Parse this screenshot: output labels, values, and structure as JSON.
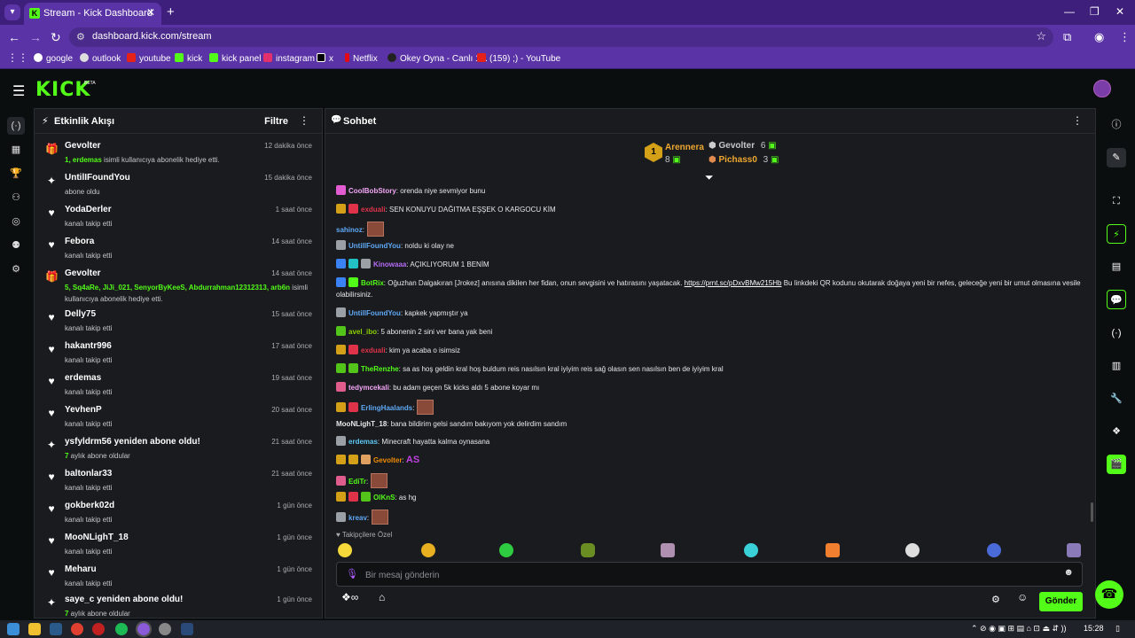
{
  "browser": {
    "tab_title": "Stream - Kick Dashboard",
    "url": "dashboard.kick.com/stream",
    "bookmarks": [
      "google",
      "outlook",
      "youtube",
      "kick",
      "kick panel",
      "instagram",
      "x",
      "Netflix",
      "Okey Oyna - Canlı 1...",
      "(159) ;) - YouTube"
    ]
  },
  "app": {
    "logo": "KICK",
    "beta": "BETA"
  },
  "feed": {
    "title": "Etkinlik Akışı",
    "filter": "Filtre",
    "events": [
      {
        "name": "Gevolter",
        "time": "12 dakika önce",
        "type": "gift",
        "desc_hl": "1, erdemas",
        "desc": " isimli kullanıcıya abonelik hediye etti."
      },
      {
        "name": "UntilIFoundYou",
        "time": "15 dakika önce",
        "type": "sub",
        "desc_hl": "",
        "desc": "abone oldu"
      },
      {
        "name": "YodaDerler",
        "time": "1 saat önce",
        "type": "follow",
        "desc_hl": "",
        "desc": "kanalı takip etti"
      },
      {
        "name": "Febora",
        "time": "14 saat önce",
        "type": "follow",
        "desc_hl": "",
        "desc": "kanalı takip etti"
      },
      {
        "name": "Gevolter",
        "time": "14 saat önce",
        "type": "gift",
        "desc_hl": "5, Sq4aRe, JiJi_021, SenyorByKeeS, Abdurrahman12312313, arb6n",
        "desc": " isimli kullanıcıya abonelik hediye etti."
      },
      {
        "name": "Delly75",
        "time": "15 saat önce",
        "type": "follow",
        "desc_hl": "",
        "desc": "kanalı takip etti"
      },
      {
        "name": "hakantr996",
        "time": "17 saat önce",
        "type": "follow",
        "desc_hl": "",
        "desc": "kanalı takip etti"
      },
      {
        "name": "erdemas",
        "time": "19 saat önce",
        "type": "follow",
        "desc_hl": "",
        "desc": "kanalı takip etti"
      },
      {
        "name": "YevhenP",
        "time": "20 saat önce",
        "type": "follow",
        "desc_hl": "",
        "desc": "kanalı takip etti"
      },
      {
        "name": "ysfyldrm56 yeniden abone oldu!",
        "time": "21 saat önce",
        "type": "resub",
        "desc_hl": "7",
        "desc": " aylık abone oldular"
      },
      {
        "name": "baltonlar33",
        "time": "21 saat önce",
        "type": "follow",
        "desc_hl": "",
        "desc": "kanalı takip etti"
      },
      {
        "name": "gokberk02d",
        "time": "1 gün önce",
        "type": "follow",
        "desc_hl": "",
        "desc": "kanalı takip etti"
      },
      {
        "name": "MooNLighT_18",
        "time": "1 gün önce",
        "type": "follow",
        "desc_hl": "",
        "desc": "kanalı takip etti"
      },
      {
        "name": "Meharu",
        "time": "1 gün önce",
        "type": "follow",
        "desc_hl": "",
        "desc": "kanalı takip etti"
      },
      {
        "name": "saye_c yeniden abone oldu!",
        "time": "1 gün önce",
        "type": "resub",
        "desc_hl": "7",
        "desc": " aylık abone oldular"
      }
    ]
  },
  "chat": {
    "title": "Sohbet",
    "leaderboard": {
      "first": {
        "name": "Arennera",
        "count": "8",
        "rank": "1"
      },
      "second": {
        "name": "Gevolter",
        "count": "6"
      },
      "third": {
        "name": "Pichass0",
        "count": "3"
      }
    },
    "messages": [
      {
        "user": "CoolBobStory",
        "color": "#f4a7f6",
        "text": "orenda niye sevmiyor bunu",
        "badges": [
          "#e05cd0"
        ],
        "emote": false
      },
      {
        "user": "exduali",
        "color": "#e0334a",
        "text": "SEN KONUYU DAĞITMA EŞŞEK O KARGOCU KİM",
        "badges": [
          "#d4a017",
          "#e0334a"
        ],
        "emote": false
      },
      {
        "user": "sahinoz",
        "color": "#5fa8f5",
        "text": "",
        "badges": [],
        "emote": true
      },
      {
        "user": "UntilIFoundYou",
        "color": "#5fa8f5",
        "text": "noldu ki olay ne",
        "badges": [
          "#9aa0a6"
        ],
        "emote": false
      },
      {
        "user": "Kinowaaa",
        "color": "#b76cf5",
        "text": "AÇIKLIYORUM 1 BENİM",
        "badges": [
          "#3b82f6",
          "#22c1c3",
          "#9aa0a6"
        ],
        "emote": false
      },
      {
        "user": "BotRix",
        "color": "#53fc18",
        "text": "Oğuzhan Dalgakıran [Jrokez] anısına dikilen her fidan, onun sevgisini ve hatırasını yaşatacak.",
        "link": "https://prnt.sc/pDxvBMw215Hb",
        "text2": "Bu linkdeki QR kodunu okutarak doğaya yeni bir nefes, geleceğe yeni bir umut olmasına vesile olabilirsiniz.",
        "badges": [
          "#3b82f6",
          "#53fc18"
        ],
        "emote": false
      },
      {
        "user": "UntilIFoundYou",
        "color": "#5fa8f5",
        "text": "kapkek yapmıştır ya",
        "badges": [
          "#9aa0a6"
        ],
        "emote": false
      },
      {
        "user": "avel_ibo",
        "color": "#8bd000",
        "text": "5 abonenin 2 sini ver bana yak beni",
        "badges": [
          "#53c41a"
        ],
        "emote": false
      },
      {
        "user": "exduali",
        "color": "#e0334a",
        "text": "kim ya acaba o isimsiz",
        "badges": [
          "#d4a017",
          "#e0334a"
        ],
        "emote": false
      },
      {
        "user": "TheRenzhe",
        "color": "#53fc18",
        "text": "sa as hoş geldin kral hoş buldum reis nasılsın kral iyiyim reis sağ olasın sen nasılsın ben de iyiyim kral",
        "badges": [
          "#53c41a",
          "#53c41a"
        ],
        "emote": false
      },
      {
        "user": "tedymcekali",
        "color": "#f4a7f6",
        "text": "bu adam geçen 5k kicks aldı 5 abone koyar mı",
        "badges": [
          "#e05c8a"
        ],
        "emote": false
      },
      {
        "user": "ErlingHaalands",
        "color": "#5fa8f5",
        "text": "",
        "badges": [
          "#d4a017",
          "#e0334a"
        ],
        "emote": true
      },
      {
        "user": "MooNLighT_18",
        "color": "#e8e8e8",
        "text": "bana bildirim gelsi sandım bakıyom yok delirdim sandım",
        "badges": [],
        "emote": false
      },
      {
        "user": "erdemas",
        "color": "#5fc8f5",
        "text": "Minecraft hayatta kalma oynasana",
        "badges": [
          "#9aa0a6"
        ],
        "emote": false
      },
      {
        "user": "Gevolter",
        "color": "#f08c00",
        "text": "AS",
        "badges": [
          "#d4a017",
          "#d4a017",
          "#e0a060"
        ],
        "emote": false,
        "purple_text": true
      },
      {
        "user": "EdiTr",
        "color": "#53fc18",
        "text": "",
        "badges": [
          "#e05c8a"
        ],
        "emote": true
      },
      {
        "user": "OlKnS",
        "color": "#53fc18",
        "text": "as hg",
        "badges": [
          "#d4a017",
          "#e0334a",
          "#53c41a"
        ],
        "emote": false
      },
      {
        "user": "kreav",
        "color": "#5fa8f5",
        "text": "",
        "badges": [
          "#9aa0a6"
        ],
        "emote": true
      }
    ],
    "followers_only": "Takipçilere Özel",
    "input_placeholder": "Bir mesaj gönderin",
    "send_label": "Gönder"
  },
  "taskbar": {
    "time": "15:28"
  }
}
